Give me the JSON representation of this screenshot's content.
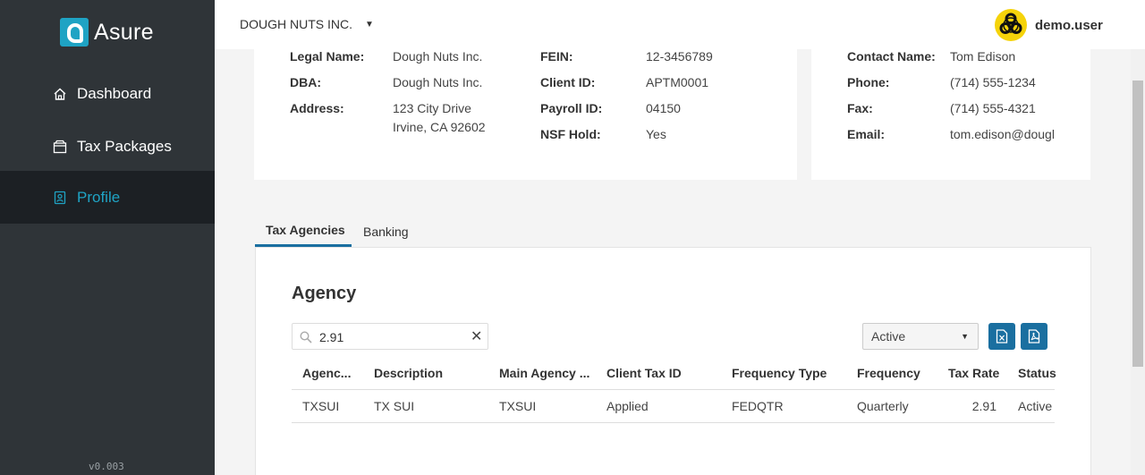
{
  "app": {
    "logo_text": "Asure",
    "version": "v0.003"
  },
  "sidebar": {
    "items": [
      {
        "label": "Dashboard",
        "icon": "home-icon"
      },
      {
        "label": "Tax Packages",
        "icon": "package-icon"
      },
      {
        "label": "Profile",
        "icon": "profile-icon",
        "active": true
      }
    ]
  },
  "header": {
    "company": "DOUGH NUTS INC.",
    "username": "demo.user",
    "avatar_icon": "biohazard-icon"
  },
  "company_info": {
    "legal_name_label": "Legal Name:",
    "legal_name": "Dough Nuts Inc.",
    "dba_label": "DBA:",
    "dba": "Dough Nuts Inc.",
    "address_label": "Address:",
    "address_line1": "123 City Drive",
    "address_line2": "Irvine, CA 92602",
    "fein_label": "FEIN:",
    "fein": "12-3456789",
    "client_id_label": "Client ID:",
    "client_id": "APTM0001",
    "payroll_id_label": "Payroll ID:",
    "payroll_id": "04150",
    "nsf_hold_label": "NSF Hold:",
    "nsf_hold": "Yes"
  },
  "contact": {
    "name_label": "Contact Name:",
    "name": "Tom Edison",
    "phone_label": "Phone:",
    "phone": "(714) 555-1234",
    "fax_label": "Fax:",
    "fax": "(714) 555-4321",
    "email_label": "Email:",
    "email": "tom.edison@dougl"
  },
  "tabs": [
    {
      "label": "Tax Agencies",
      "active": true
    },
    {
      "label": "Banking"
    }
  ],
  "agency": {
    "title": "Agency",
    "search_value": "2.91",
    "status_filter": "Active",
    "columns": [
      "Agenc...",
      "Description",
      "Main Agency ...",
      "Client Tax ID",
      "Frequency Type",
      "Frequency",
      "Tax Rate",
      "Status"
    ],
    "rows": [
      [
        "TXSUI",
        "TX SUI",
        "TXSUI",
        "Applied",
        "FEDQTR",
        "Quarterly",
        "2.91",
        "Active"
      ]
    ]
  },
  "colors": {
    "sidebar_bg": "#2f3438",
    "accent": "#1fa3c4",
    "button_blue": "#1a6fa0",
    "avatar_yellow": "#f5d30a"
  }
}
